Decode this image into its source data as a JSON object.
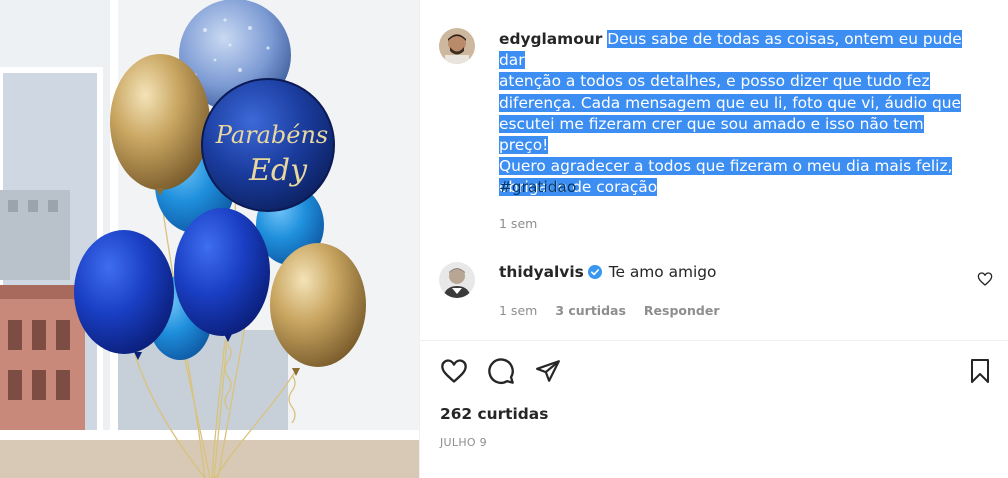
{
  "post": {
    "author": "edyglamour",
    "caption_lines": [
      "Deus sabe de todas as coisas, ontem eu pude dar",
      "atenção a todos os detalhes, e posso dizer que tudo fez",
      "diferença. Cada mensagem que eu li, foto que vi, áudio que",
      "escutei me fizeram crer que sou amado e isso não tem preço!",
      "Quero agradecer a todos que fizeram o meu dia mais feliz,",
      "obrigado de coração"
    ],
    "hashtag": "#gratidao",
    "caption_time": "1 sem",
    "balloon_text_line1": "Parabéns",
    "balloon_text_line2": "Edy"
  },
  "comment": {
    "username": "thidyalvis",
    "text": "Te amo amigo",
    "time": "1 sem",
    "likes": "3 curtidas",
    "reply_label": "Responder"
  },
  "footer": {
    "likes_count": "262 curtidas",
    "date": "JULHO 9"
  },
  "colors": {
    "selection": "#3d8ef2",
    "verified": "#3897f0",
    "hashtag": "#00376b",
    "muted": "#8e8e8e"
  },
  "icons": {
    "like": "heart-icon",
    "comment": "comment-icon",
    "share": "paper-plane-icon",
    "save": "bookmark-icon",
    "comment_like": "heart-icon",
    "verified": "verified-badge-icon"
  }
}
